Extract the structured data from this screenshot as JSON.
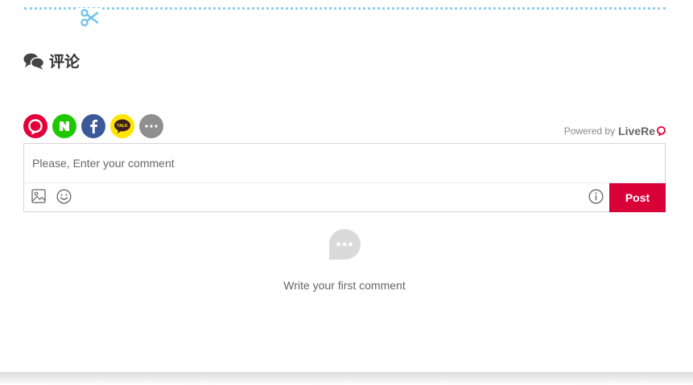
{
  "section": {
    "title": "评论"
  },
  "social": [
    {
      "name": "livere",
      "color": "#e3003a"
    },
    {
      "name": "naver",
      "color": "#1ec800",
      "letter": "N"
    },
    {
      "name": "facebook",
      "color": "#3b5998",
      "letter": "f"
    },
    {
      "name": "kakaotalk",
      "color": "#ffe600",
      "letter": "TALK"
    },
    {
      "name": "more",
      "color": "#8f8f8f",
      "letter": "···"
    }
  ],
  "powered": {
    "prefix": "Powered by",
    "brand": "LiveRe"
  },
  "comment": {
    "placeholder": "Please, Enter your comment",
    "post_label": "Post",
    "accent_color": "#d9003a"
  },
  "empty": {
    "message": "Write your first comment"
  }
}
